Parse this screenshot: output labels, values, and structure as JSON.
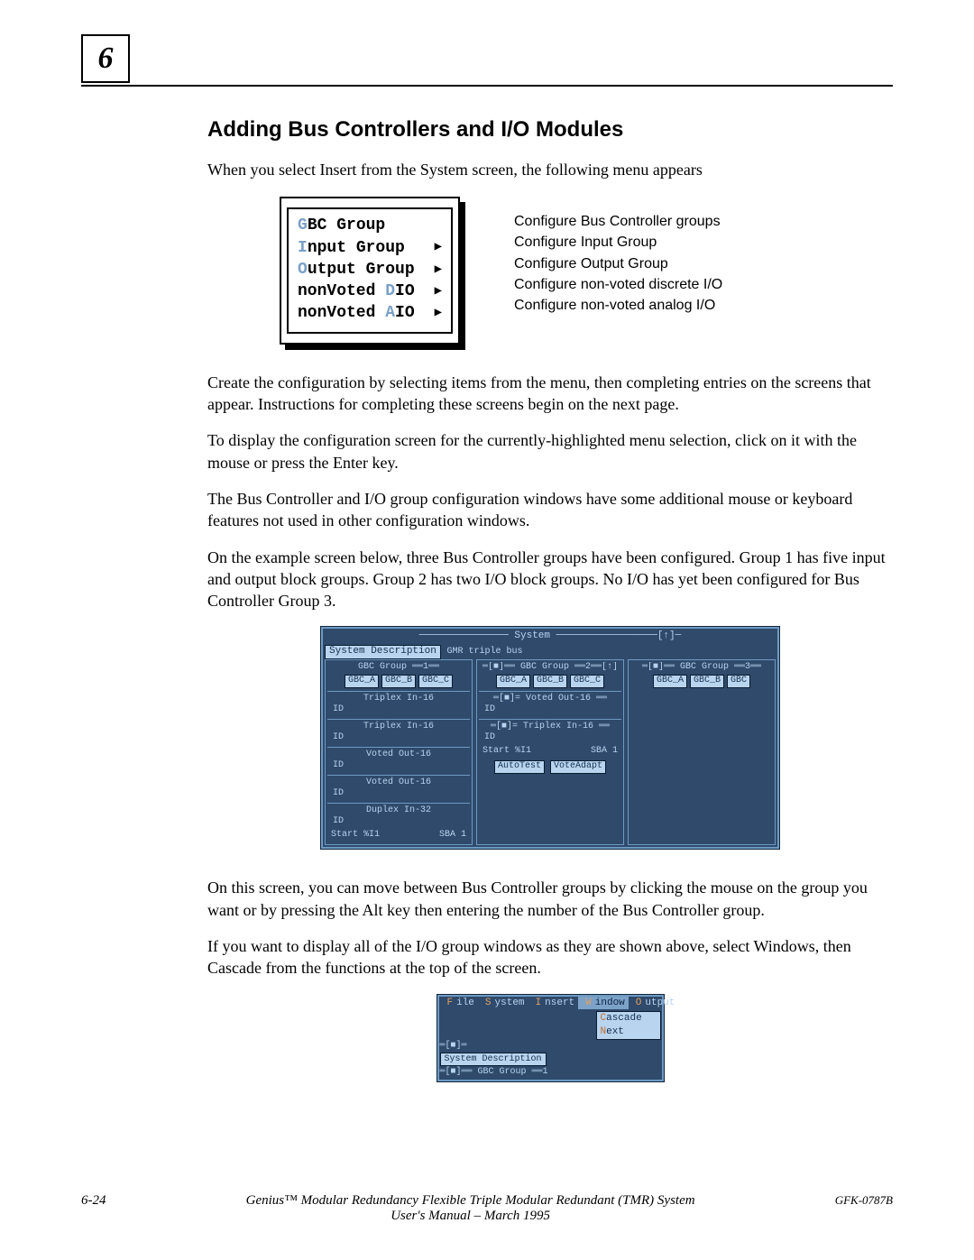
{
  "page_number_box": "6",
  "heading": "Adding Bus Controllers and I/O Modules",
  "intro": "When you select Insert from the System screen, the following menu appears",
  "menu": {
    "items": [
      {
        "hl": "G",
        "rest": "BC Group",
        "arrow": false
      },
      {
        "hl": "I",
        "rest": "nput Group",
        "arrow": true
      },
      {
        "hl": "O",
        "rest": "utput Group",
        "arrow": true
      },
      {
        "pre": "nonVoted ",
        "hl": "D",
        "post": "IO",
        "arrow": true
      },
      {
        "pre": "nonVoted ",
        "hl": "A",
        "post": "IO",
        "arrow": true
      }
    ],
    "captions": [
      "Configure Bus Controller groups",
      "Configure Input Group",
      "Configure Output Group",
      "Configure non-voted discrete I/O",
      "Configure non-voted analog I/O"
    ]
  },
  "para1": "Create the configuration by selecting items from the menu, then completing entries on the screens that appear. Instructions for completing these screens begin on the next page.",
  "para2": "To display the configuration screen for the currently-highlighted menu selection, click on it with the mouse or  press the Enter key.",
  "para3": "The Bus Controller and I/O group configuration windows have some additional mouse or keyboard features not used in other configuration windows.",
  "para4": "On the  example screen below, three Bus Controller groups have been configured. Group 1 has five input and output block groups. Group 2 has two I/O block groups. No I/O has yet been configured for Bus Controller Group 3.",
  "system_screen": {
    "title": "System",
    "sys_desc": "System Description",
    "sub_title": "GMR triple bus",
    "groups": [
      {
        "name": "GBC Group ══1══",
        "tabs": [
          "GBC_A",
          "GBC_B",
          "GBC_C"
        ],
        "blocks": [
          "Triplex In-16",
          "Triplex In-16",
          "Voted Out-16",
          "Voted Out-16",
          "Duplex In-32"
        ],
        "bottom_left": "Start %I1",
        "bottom_right": "SBA 1"
      },
      {
        "name": "GBC Group ══2══",
        "tabs": [
          "GBC_A",
          "GBC_B",
          "GBC_C"
        ],
        "voted_block": "Voted Out-16",
        "triplex_block": "Triplex In-16",
        "start": "Start %I1",
        "sba": "SBA 1",
        "buttons": [
          "AutoTest",
          "VoteAdapt"
        ]
      },
      {
        "name": "GBC Group ══3══",
        "tabs": [
          "GBC_A",
          "GBC_B",
          "GBC"
        ]
      }
    ],
    "id_label": "ID"
  },
  "para5": "On this screen, you can move between Bus Controller groups by clicking the mouse on the group you want or by pressing the Alt key then entering the number of the Bus Controller group.",
  "para6": "If you want to display all of the I/O group windows as they are shown above, select Windows, then Cascade from the functions at the top of the screen.",
  "window_menu": {
    "menubar": [
      "File",
      "System",
      "Insert",
      "Window",
      "Output"
    ],
    "dropdown": [
      "Cascade",
      "Next"
    ],
    "below_pill": "System Description",
    "below_text": "═[■]══ GBC Group ══1"
  },
  "footer": {
    "page": "6-24",
    "title_line1": "Genius™ Modular Redundancy Flexible Triple Modular Redundant (TMR) System",
    "title_line2": "User's Manual – March 1995",
    "doc": "GFK-0787B"
  }
}
